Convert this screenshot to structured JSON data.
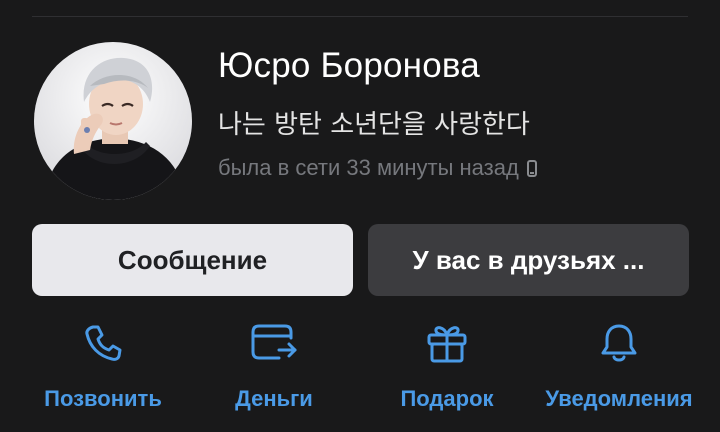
{
  "profile": {
    "name": "Юсро Боронова",
    "status": "나는 방탄 소년단을 사랑한다",
    "last_seen": "была в сети 33 минуты назад",
    "last_seen_device_icon": "mobile-phone-icon",
    "avatar": "profile-photo"
  },
  "buttons": {
    "message_label": "Сообщение",
    "friends_label": "У вас в друзьях ..."
  },
  "actions": [
    {
      "label": "Позвонить",
      "icon": "phone-icon"
    },
    {
      "label": "Деньги",
      "icon": "money-transfer-icon"
    },
    {
      "label": "Подарок",
      "icon": "gift-icon"
    },
    {
      "label": "Уведомления",
      "icon": "bell-icon"
    }
  ],
  "colors": {
    "background": "#19191a",
    "accent": "#4a9ae6",
    "primary_button_bg": "#e8e8ec",
    "secondary_button_bg": "#3c3c3f",
    "muted_text": "#76787d"
  }
}
